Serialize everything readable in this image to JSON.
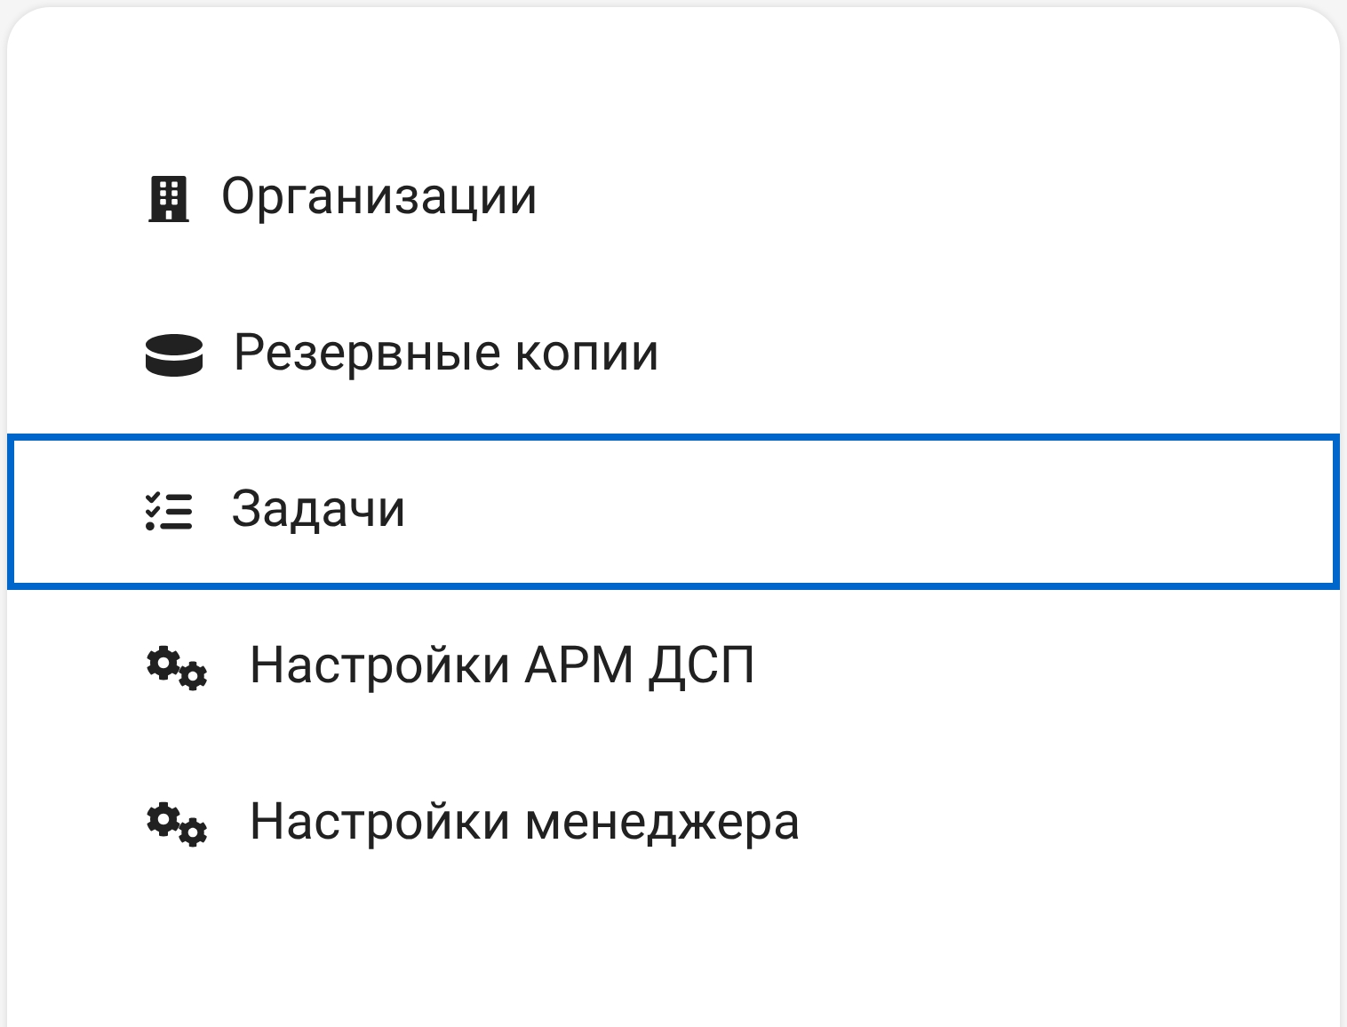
{
  "menu": [
    {
      "label": "Организации",
      "selected": false
    },
    {
      "label": "Резервные копии",
      "selected": false
    },
    {
      "label": "Задачи",
      "selected": true
    },
    {
      "label": "Настройки АРМ ДСП",
      "selected": false
    },
    {
      "label": "Настройки менеджера",
      "selected": false
    }
  ]
}
